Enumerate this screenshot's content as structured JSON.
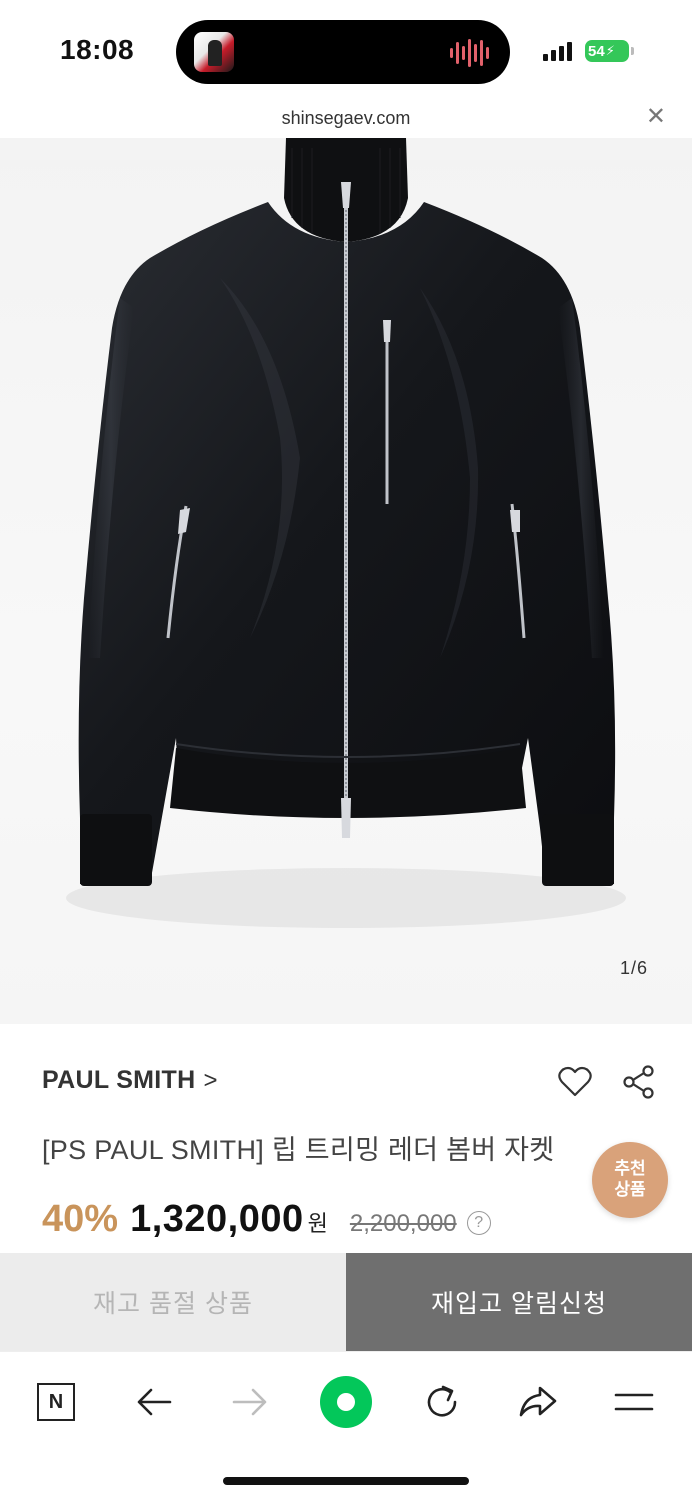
{
  "status_bar": {
    "time": "18:08",
    "battery": "54",
    "icons": [
      "cellular-signal-icon",
      "battery-charging-icon"
    ]
  },
  "browser": {
    "url": "shinsegaev.com",
    "close_icon": "close-icon"
  },
  "gallery": {
    "page_indicator": "1/6"
  },
  "product": {
    "brand": "PAUL SMITH",
    "brand_chevron": ">",
    "title": "[PS PAUL SMITH] 립 트리밍 레더 봄버 자켓",
    "discount": "40%",
    "price": "1,320,000",
    "currency": "원",
    "original_price": "2,200,000",
    "help_icon": "?"
  },
  "badge": {
    "line1": "추천",
    "line2": "상품"
  },
  "actions": {
    "sold_out_label": "재고 품절 상품",
    "restock_label": "재입고 알림신청"
  },
  "toolbar": {
    "items": [
      "naver-home-icon",
      "back-arrow-icon",
      "forward-arrow-icon",
      "green-dot-icon",
      "reload-icon",
      "share-arrow-icon",
      "menu-icon"
    ],
    "naver_letter": "N"
  },
  "colors": {
    "discount": "#c9945b",
    "badge": "#d9a27a",
    "restock_button": "#6f6f6f",
    "sold_out_button": "#ececec",
    "green": "#03c75a",
    "battery": "#34c759"
  }
}
